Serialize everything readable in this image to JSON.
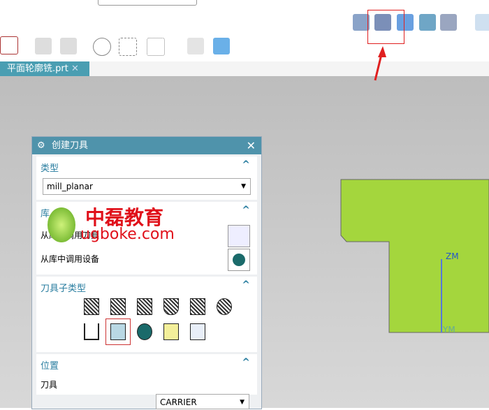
{
  "tab": {
    "label": "平面轮廓铣.prt"
  },
  "dialog": {
    "title": "创建刀具",
    "type": {
      "label": "类型",
      "value": "mill_planar"
    },
    "library": {
      "label": "库",
      "call_tool": "从库中调用刀具",
      "call_device": "从库中调用设备"
    },
    "subtype": {
      "label": "刀具子类型",
      "selected": "CARRIER icon (row 2, item 2)"
    },
    "position": {
      "label": "位置",
      "tool_label": "刀具",
      "tool_value": "CARRIER"
    }
  },
  "watermark": {
    "cn": "中磊教育",
    "url": "ugboke.com"
  },
  "axes": {
    "z": "ZM",
    "y": "YM"
  },
  "colors": {
    "accent": "#4f93ab",
    "part": "#a4d63d",
    "annotation": "#e02020"
  }
}
